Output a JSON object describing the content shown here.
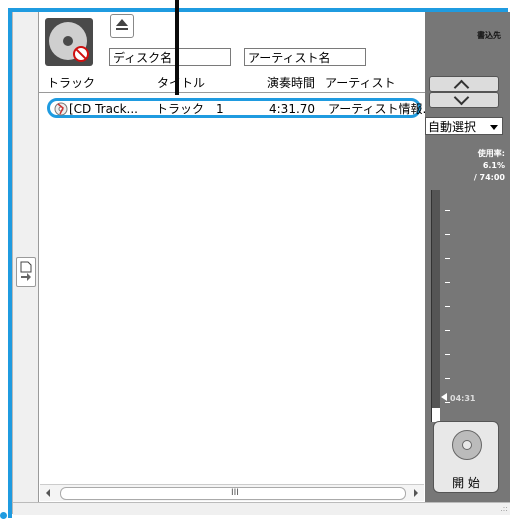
{
  "header": {
    "burn_label": "書込先",
    "disc_name_placeholder": "ディスク名",
    "artist_name_placeholder": "アーティスト名"
  },
  "columns": {
    "track": "トラック",
    "title": "タイトル",
    "duration": "演奏時間",
    "artist": "アーティスト"
  },
  "tracks": [
    {
      "track": "[CD Track...",
      "title": "トラック　1",
      "duration": "4:31.70",
      "artist": "アーティスト情報."
    }
  ],
  "side_panel": {
    "auto_select_label": "自動選択",
    "usage_label": "使用率:",
    "usage_percent": "6.1%",
    "total_time": "/ 74:00",
    "current_time": "04:31",
    "usage_fraction": 0.061,
    "start_label": "開 始"
  },
  "scrollbar": {
    "grip": "III"
  },
  "colors": {
    "highlight": "#1f9be0",
    "panel": "#777777"
  },
  "icons": {
    "disc": "disc-blocked-icon",
    "eject": "eject-icon",
    "track_row": "cd-track-icon",
    "start": "burn-disc-icon",
    "side": "document-arrow-icon"
  }
}
